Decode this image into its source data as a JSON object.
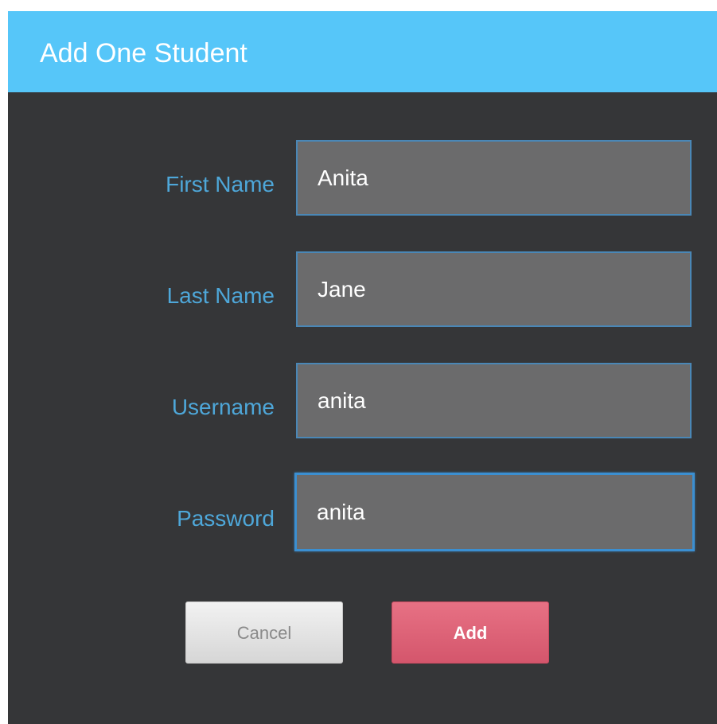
{
  "dialog": {
    "title": "Add One Student"
  },
  "form": {
    "fields": [
      {
        "label": "First Name",
        "value": "Anita"
      },
      {
        "label": "Last Name",
        "value": "Jane"
      },
      {
        "label": "Username",
        "value": "anita"
      },
      {
        "label": "Password",
        "value": "anita",
        "focused": true
      }
    ]
  },
  "buttons": {
    "cancel_label": "Cancel",
    "add_label": "Add"
  },
  "colors": {
    "header_bg": "#56c6f9",
    "body_bg": "#353638",
    "label_text": "#4ea7d9",
    "input_bg": "#6b6b6c",
    "add_button": "#d4566c"
  }
}
